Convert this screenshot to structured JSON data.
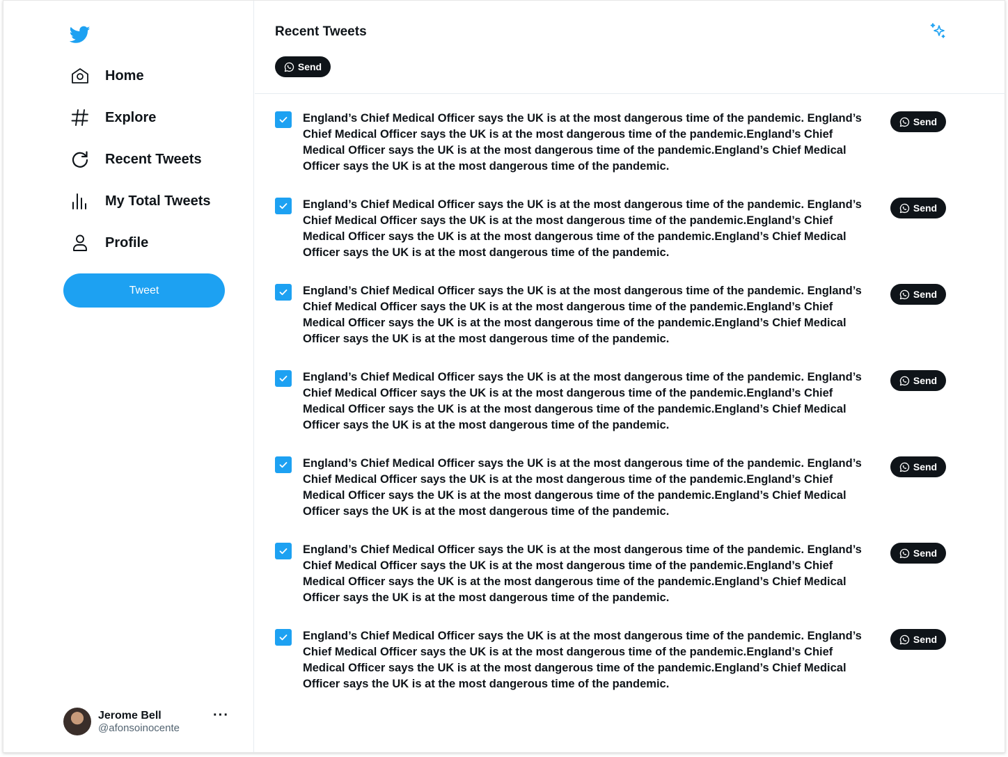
{
  "sidebar": {
    "logo": "twitter-bird-icon",
    "nav": [
      {
        "label": "Home",
        "icon": "home-icon"
      },
      {
        "label": "Explore",
        "icon": "hashtag-icon"
      },
      {
        "label": "Recent Tweets",
        "icon": "refresh-icon"
      },
      {
        "label": "My Total Tweets",
        "icon": "bar-chart-icon"
      },
      {
        "label": "Profile",
        "icon": "user-icon"
      }
    ],
    "tweet_button": "Tweet",
    "user": {
      "name": "Jerome Bell",
      "handle": "@afonsoinocente",
      "more": "···"
    }
  },
  "main": {
    "title": "Recent Tweets",
    "header_send": "Send",
    "tweets": [
      {
        "checked": true,
        "text": "England’s Chief Medical Officer says the UK is at the most dangerous time of the pandemic. England’s Chief Medical Officer says the UK is at the most dangerous time of the pandemic.England’s Chief Medical Officer says the UK is at the most dangerous time of the pandemic.England’s Chief Medical Officer says the UK is at the most dangerous time of the pandemic.",
        "send": "Send"
      },
      {
        "checked": true,
        "text": "England’s Chief Medical Officer says the UK is at the most dangerous time of the pandemic. England’s Chief Medical Officer says the UK is at the most dangerous time of the pandemic.England’s Chief Medical Officer says the UK is at the most dangerous time of the pandemic.England’s Chief Medical Officer says the UK is at the most dangerous time of the pandemic.",
        "send": "Send"
      },
      {
        "checked": true,
        "text": "England’s Chief Medical Officer says the UK is at the most dangerous time of the pandemic. England’s Chief Medical Officer says the UK is at the most dangerous time of the pandemic.England’s Chief Medical Officer says the UK is at the most dangerous time of the pandemic.England’s Chief Medical Officer says the UK is at the most dangerous time of the pandemic.",
        "send": "Send"
      },
      {
        "checked": true,
        "text": "England’s Chief Medical Officer says the UK is at the most dangerous time of the pandemic. England’s Chief Medical Officer says the UK is at the most dangerous time of the pandemic.England’s Chief Medical Officer says the UK is at the most dangerous time of the pandemic.England’s Chief Medical Officer says the UK is at the most dangerous time of the pandemic.",
        "send": "Send"
      },
      {
        "checked": true,
        "text": "England’s Chief Medical Officer says the UK is at the most dangerous time of the pandemic. England’s Chief Medical Officer says the UK is at the most dangerous time of the pandemic.England’s Chief Medical Officer says the UK is at the most dangerous time of the pandemic.England’s Chief Medical Officer says the UK is at the most dangerous time of the pandemic.",
        "send": "Send"
      },
      {
        "checked": true,
        "text": "England’s Chief Medical Officer says the UK is at the most dangerous time of the pandemic. England’s Chief Medical Officer says the UK is at the most dangerous time of the pandemic.England’s Chief Medical Officer says the UK is at the most dangerous time of the pandemic.England’s Chief Medical Officer says the UK is at the most dangerous time of the pandemic.",
        "send": "Send"
      },
      {
        "checked": true,
        "text": "England’s Chief Medical Officer says the UK is at the most dangerous time of the pandemic. England’s Chief Medical Officer says the UK is at the most dangerous time of the pandemic.England’s Chief Medical Officer says the UK is at the most dangerous time of the pandemic.England’s Chief Medical Officer says the UK is at the most dangerous time of the pandemic.",
        "send": "Send"
      }
    ]
  },
  "colors": {
    "accent": "#1da1f2",
    "dark": "#0f1419",
    "muted": "#536471",
    "border": "#e6ecf0"
  }
}
